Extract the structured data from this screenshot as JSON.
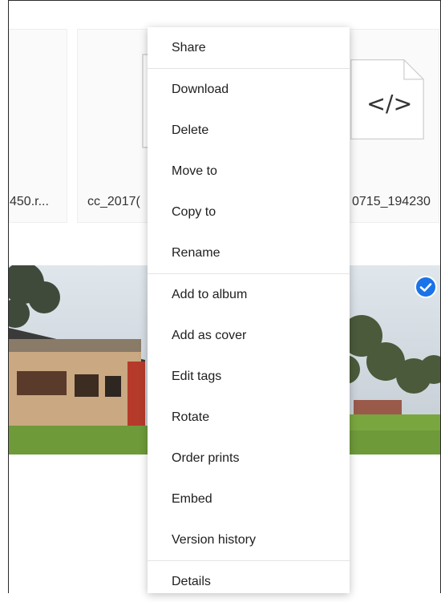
{
  "tiles": [
    {
      "name": "450.r..."
    },
    {
      "name": "cc_2017("
    },
    {
      "name": "0715_194230"
    }
  ],
  "code_file_icon_glyph": "</>",
  "photo": {
    "selected": true
  },
  "colors": {
    "accent": "#1a73e8"
  },
  "context_menu": {
    "groups": [
      [
        {
          "label": "Share"
        }
      ],
      [
        {
          "label": "Download"
        },
        {
          "label": "Delete"
        },
        {
          "label": "Move to"
        },
        {
          "label": "Copy to"
        },
        {
          "label": "Rename"
        }
      ],
      [
        {
          "label": "Add to album"
        },
        {
          "label": "Add as cover"
        },
        {
          "label": "Edit tags"
        },
        {
          "label": "Rotate"
        },
        {
          "label": "Order prints"
        },
        {
          "label": "Embed"
        },
        {
          "label": "Version history"
        }
      ],
      [
        {
          "label": "Details"
        }
      ]
    ]
  }
}
